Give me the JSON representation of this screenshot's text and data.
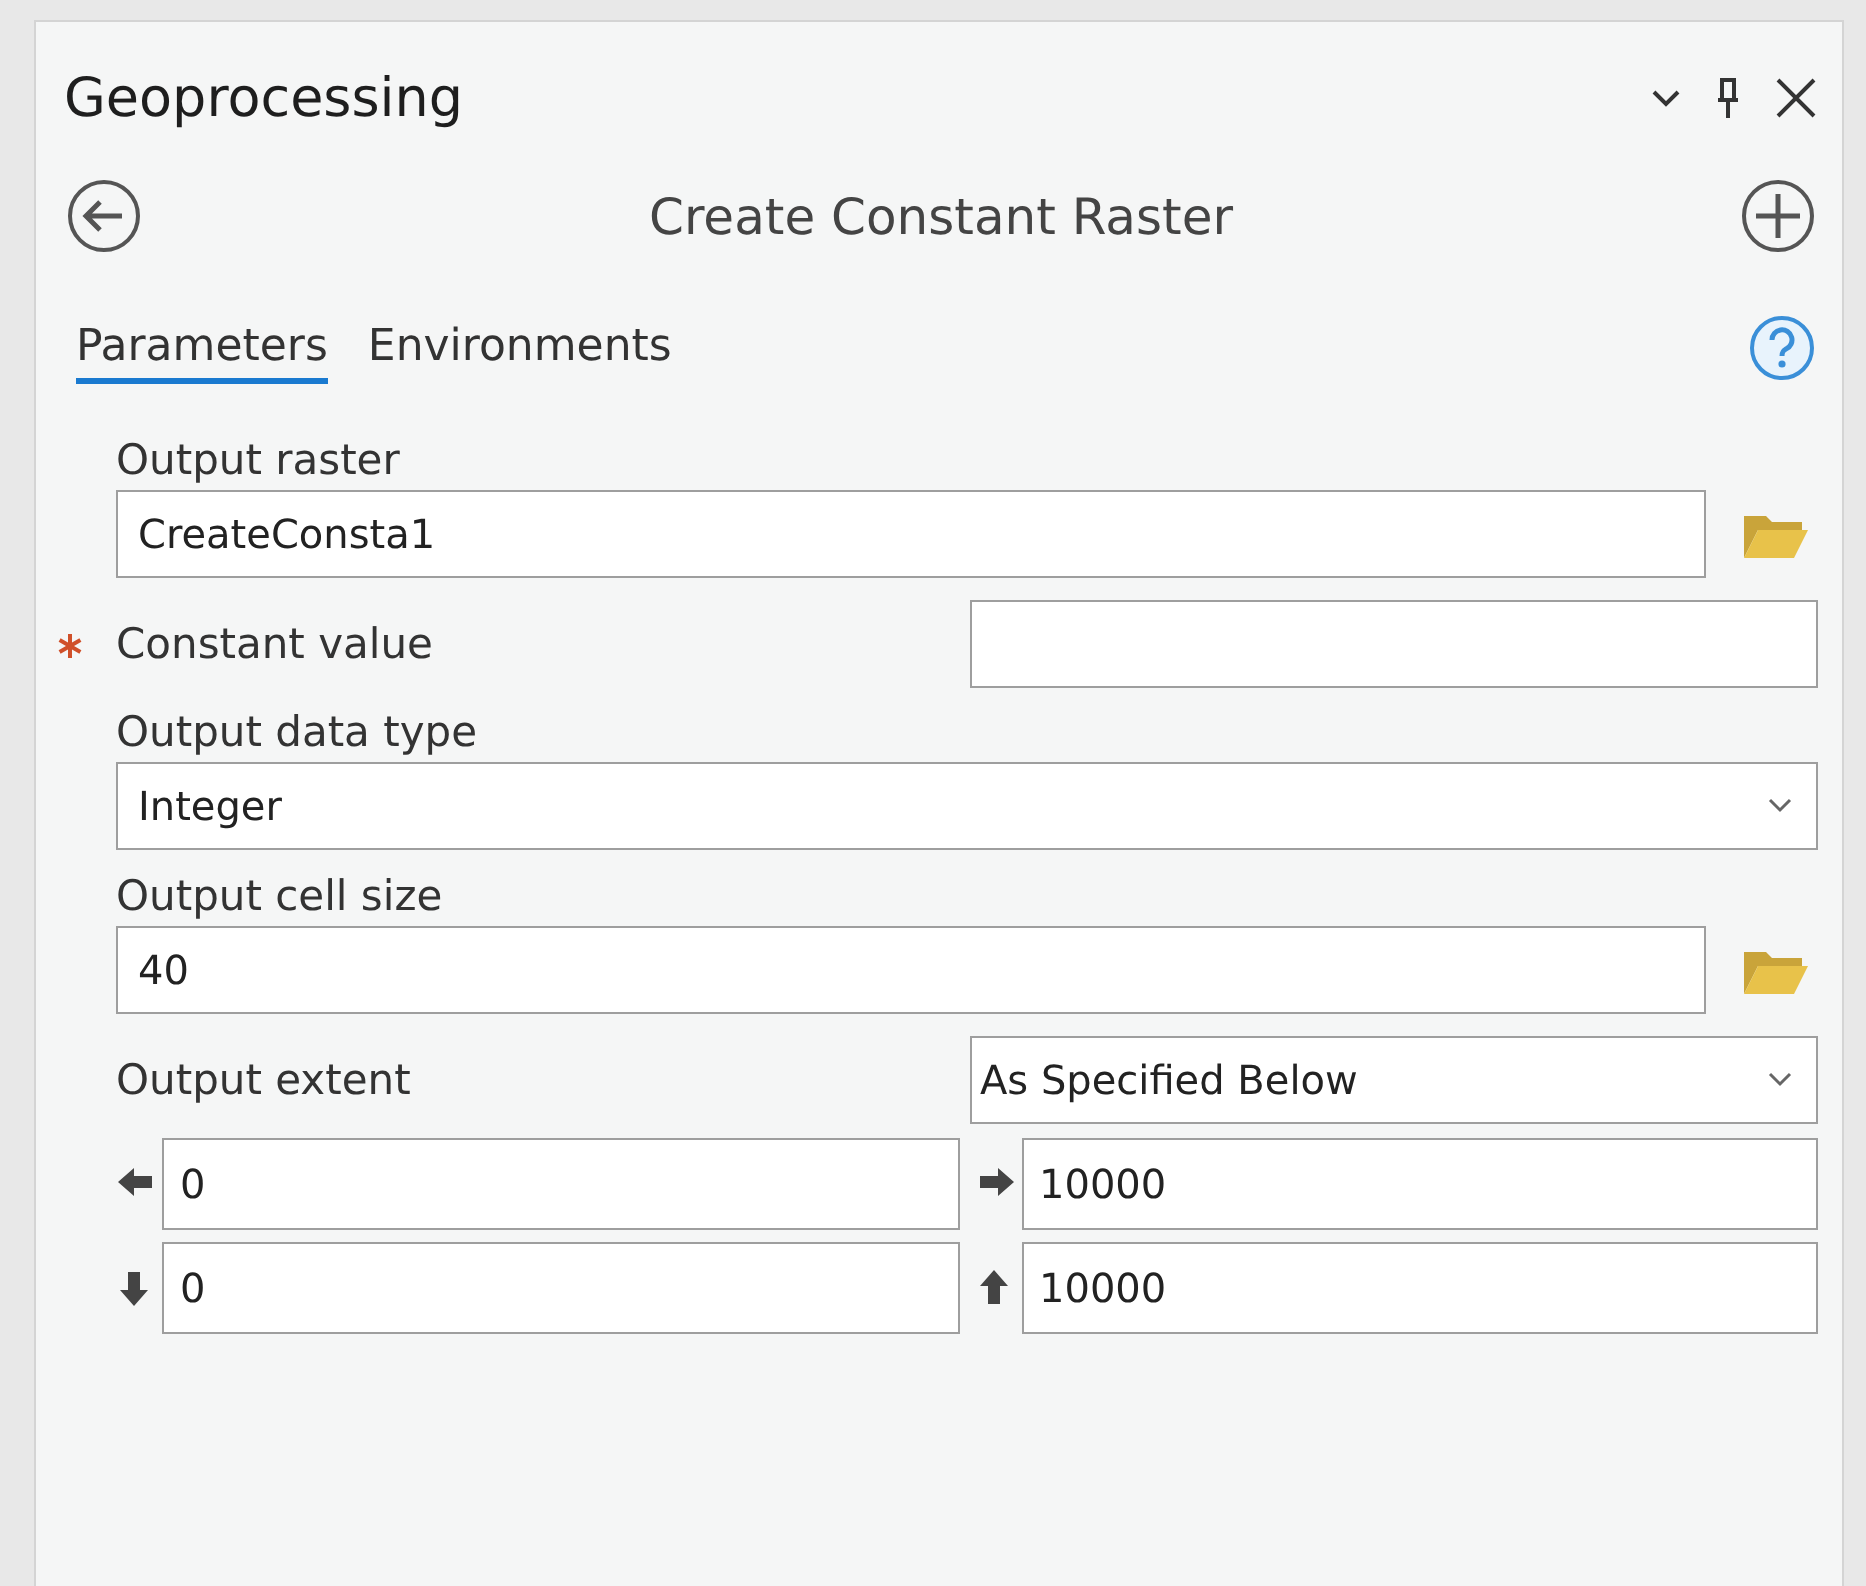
{
  "panel": {
    "title": "Geoprocessing"
  },
  "tool": {
    "title": "Create Constant Raster"
  },
  "tabs": [
    {
      "label": "Parameters",
      "selected": true
    },
    {
      "label": "Environments",
      "selected": false
    }
  ],
  "parameters": [
    {
      "kind": "browse",
      "label": "Output raster",
      "value": "CreateConsta1",
      "required": false
    },
    {
      "kind": "inline-text",
      "label": "Constant value",
      "required": true
    },
    {
      "kind": "dropdown",
      "label": "Output data type",
      "value": "Integer",
      "required": false
    },
    {
      "kind": "browse",
      "label": "Output cell size",
      "value": "40",
      "required": false
    },
    {
      "kind": "inline-dropdown",
      "label": "Output extent",
      "value": "As Specified Below",
      "required": false
    }
  ],
  "extent": [
    {
      "kind": "left",
      "value": "0"
    },
    {
      "kind": "right",
      "value": "10000"
    },
    {
      "kind": "down",
      "value": "0"
    },
    {
      "kind": "up",
      "value": "10000"
    }
  ]
}
